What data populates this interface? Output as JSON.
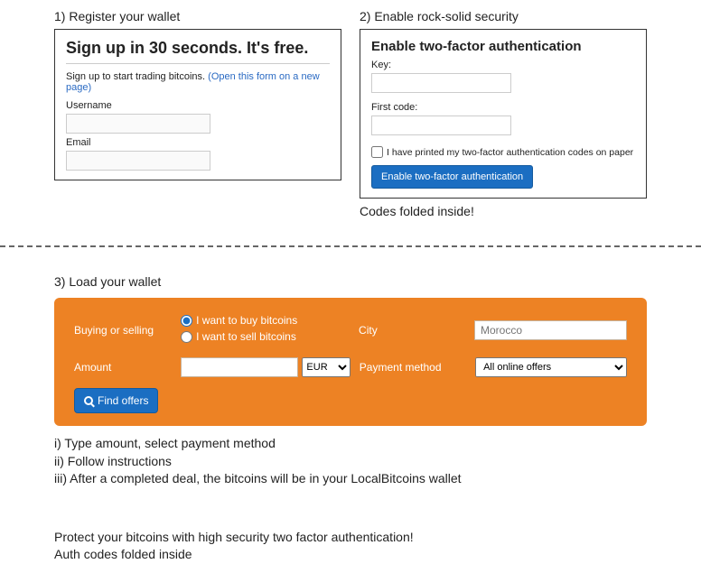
{
  "step1": {
    "title": "1) Register your wallet",
    "signup_heading": "Sign up in 30 seconds. It's free.",
    "signup_text": "Sign up to start trading bitcoins. ",
    "signup_link": "(Open this form on a new page)",
    "username_label": "Username",
    "email_label": "Email"
  },
  "step2": {
    "title": "2) Enable rock-solid security",
    "panel_heading": "Enable two-factor authentication",
    "key_label": "Key:",
    "firstcode_label": "First code:",
    "checkbox_text": "I have printed my two-factor authentication codes on paper",
    "button_label": "Enable two-factor authentication",
    "caption": "Codes folded inside!"
  },
  "step3": {
    "title": "3) Load your wallet",
    "buying_label": "Buying or selling",
    "radio_buy": "I want to buy bitcoins",
    "radio_sell": "I want to sell bitcoins",
    "city_label": "City",
    "city_placeholder": "Morocco",
    "amount_label": "Amount",
    "currency": "EUR",
    "payment_label": "Payment method",
    "payment_option": "All online offers",
    "find_label": "Find offers",
    "note_i": "i) Type amount, select payment method",
    "note_ii": "ii) Follow instructions",
    "note_iii": "iii) After a completed deal, the bitcoins will be in your LocalBitcoins wallet"
  },
  "footer": {
    "line1": "Protect your bitcoins with high security two factor authentication!",
    "line2": "Auth codes folded inside"
  }
}
